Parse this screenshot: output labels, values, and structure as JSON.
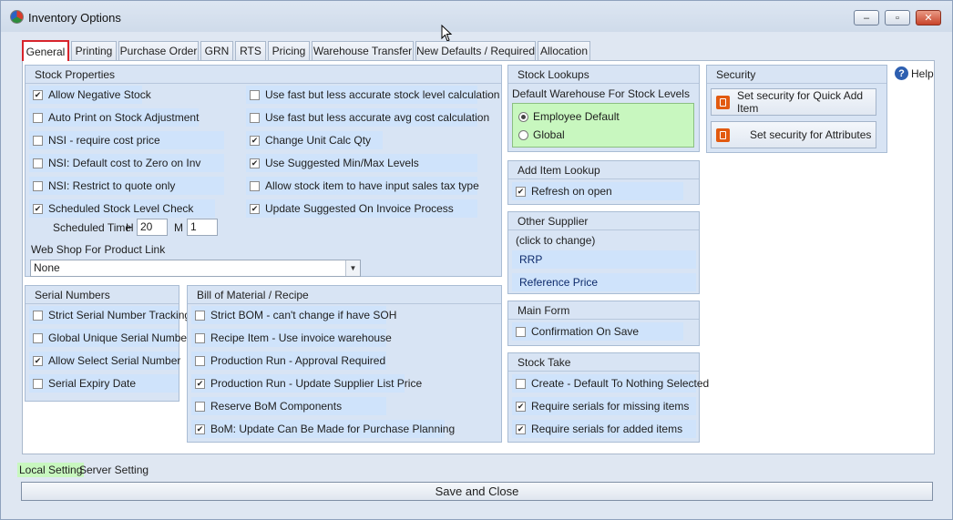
{
  "window": {
    "title": "Inventory Options",
    "minimize": "–",
    "maximize": "▫",
    "close": "✕"
  },
  "tabs": [
    {
      "label": "General"
    },
    {
      "label": "Printing"
    },
    {
      "label": "Purchase Order"
    },
    {
      "label": "GRN"
    },
    {
      "label": "RTS"
    },
    {
      "label": "Pricing"
    },
    {
      "label": "Warehouse Transfer"
    },
    {
      "label": "New Defaults / Required"
    },
    {
      "label": "Allocation"
    }
  ],
  "active_tab": "General",
  "stock_properties": {
    "title": "Stock Properties",
    "left_options": [
      {
        "label": "Allow Negative Stock",
        "checked": true
      },
      {
        "label": "Auto Print on Stock Adjustment",
        "checked": false
      },
      {
        "label": "NSI - require cost price",
        "checked": false
      },
      {
        "label": "NSI: Default cost to Zero on Inv",
        "checked": false
      },
      {
        "label": "NSI: Restrict to quote only",
        "checked": false
      },
      {
        "label": "Scheduled Stock Level Check",
        "checked": true
      }
    ],
    "right_options": [
      {
        "label": "Use fast but less accurate stock level calculation",
        "checked": false
      },
      {
        "label": "Use fast but less accurate avg cost calculation",
        "checked": false
      },
      {
        "label": "Change Unit Calc Qty",
        "checked": true
      },
      {
        "label": "Use Suggested Min/Max Levels",
        "checked": true
      },
      {
        "label": "Allow stock item to have input sales tax type",
        "checked": false
      },
      {
        "label": "Update Suggested On Invoice Process",
        "checked": true
      }
    ],
    "scheduled_time_label": "Scheduled Time",
    "hour_label": "H",
    "hour_value": "20",
    "minute_label": "M",
    "minute_value": "1",
    "web_shop_label": "Web Shop For Product Link",
    "web_shop_value": "None"
  },
  "serial_numbers": {
    "title": "Serial Numbers",
    "options": [
      {
        "label": "Strict Serial Number Tracking",
        "checked": false
      },
      {
        "label": "Global Unique Serial Numbers",
        "checked": false
      },
      {
        "label": "Allow Select Serial Number",
        "checked": true
      },
      {
        "label": "Serial Expiry Date",
        "checked": false
      }
    ]
  },
  "bom": {
    "title": "Bill of Material / Recipe",
    "options": [
      {
        "label": "Strict BOM - can't change if have SOH",
        "checked": false
      },
      {
        "label": "Recipe Item - Use invoice warehouse",
        "checked": false
      },
      {
        "label": "Production Run - Approval Required",
        "checked": false
      },
      {
        "label": "Production Run - Update Supplier List Price",
        "checked": true
      },
      {
        "label": "Reserve BoM Components",
        "checked": false
      },
      {
        "label": "BoM: Update Can Be Made for Purchase Planning",
        "checked": true
      }
    ]
  },
  "stock_lookups": {
    "title": "Stock Lookups",
    "subtitle": "Default Warehouse For Stock Levels",
    "options": [
      {
        "label": "Employee Default",
        "selected": true
      },
      {
        "label": "Global",
        "selected": false
      }
    ]
  },
  "add_item_lookup": {
    "title": "Add Item Lookup",
    "options": [
      {
        "label": "Refresh on open",
        "checked": true
      }
    ]
  },
  "other_supplier": {
    "title": "Other Supplier",
    "hint": "(click to change)",
    "links": [
      "RRP",
      "Reference Price"
    ]
  },
  "main_form": {
    "title": "Main Form",
    "options": [
      {
        "label": "Confirmation On Save",
        "checked": false
      }
    ]
  },
  "stock_take": {
    "title": "Stock Take",
    "options": [
      {
        "label": "Create - Default To Nothing Selected",
        "checked": false
      },
      {
        "label": "Require serials for missing items",
        "checked": true
      },
      {
        "label": "Require serials for added items",
        "checked": true
      }
    ]
  },
  "security": {
    "title": "Security",
    "buttons": [
      "Set security for Quick Add Item",
      "Set security for Attributes"
    ]
  },
  "help": {
    "label": "Help",
    "icon": "?"
  },
  "footer": {
    "local_setting": "Local Setting",
    "server_setting": "Server Setting",
    "save_close": "Save and Close"
  },
  "colors": {
    "option_bg": "#cfe3fb",
    "group_bg": "#d8e4f4",
    "radio_bg": "#c8f7bf",
    "local_highlight": "#c8f7bf",
    "active_tab_border": "#d8242b"
  }
}
